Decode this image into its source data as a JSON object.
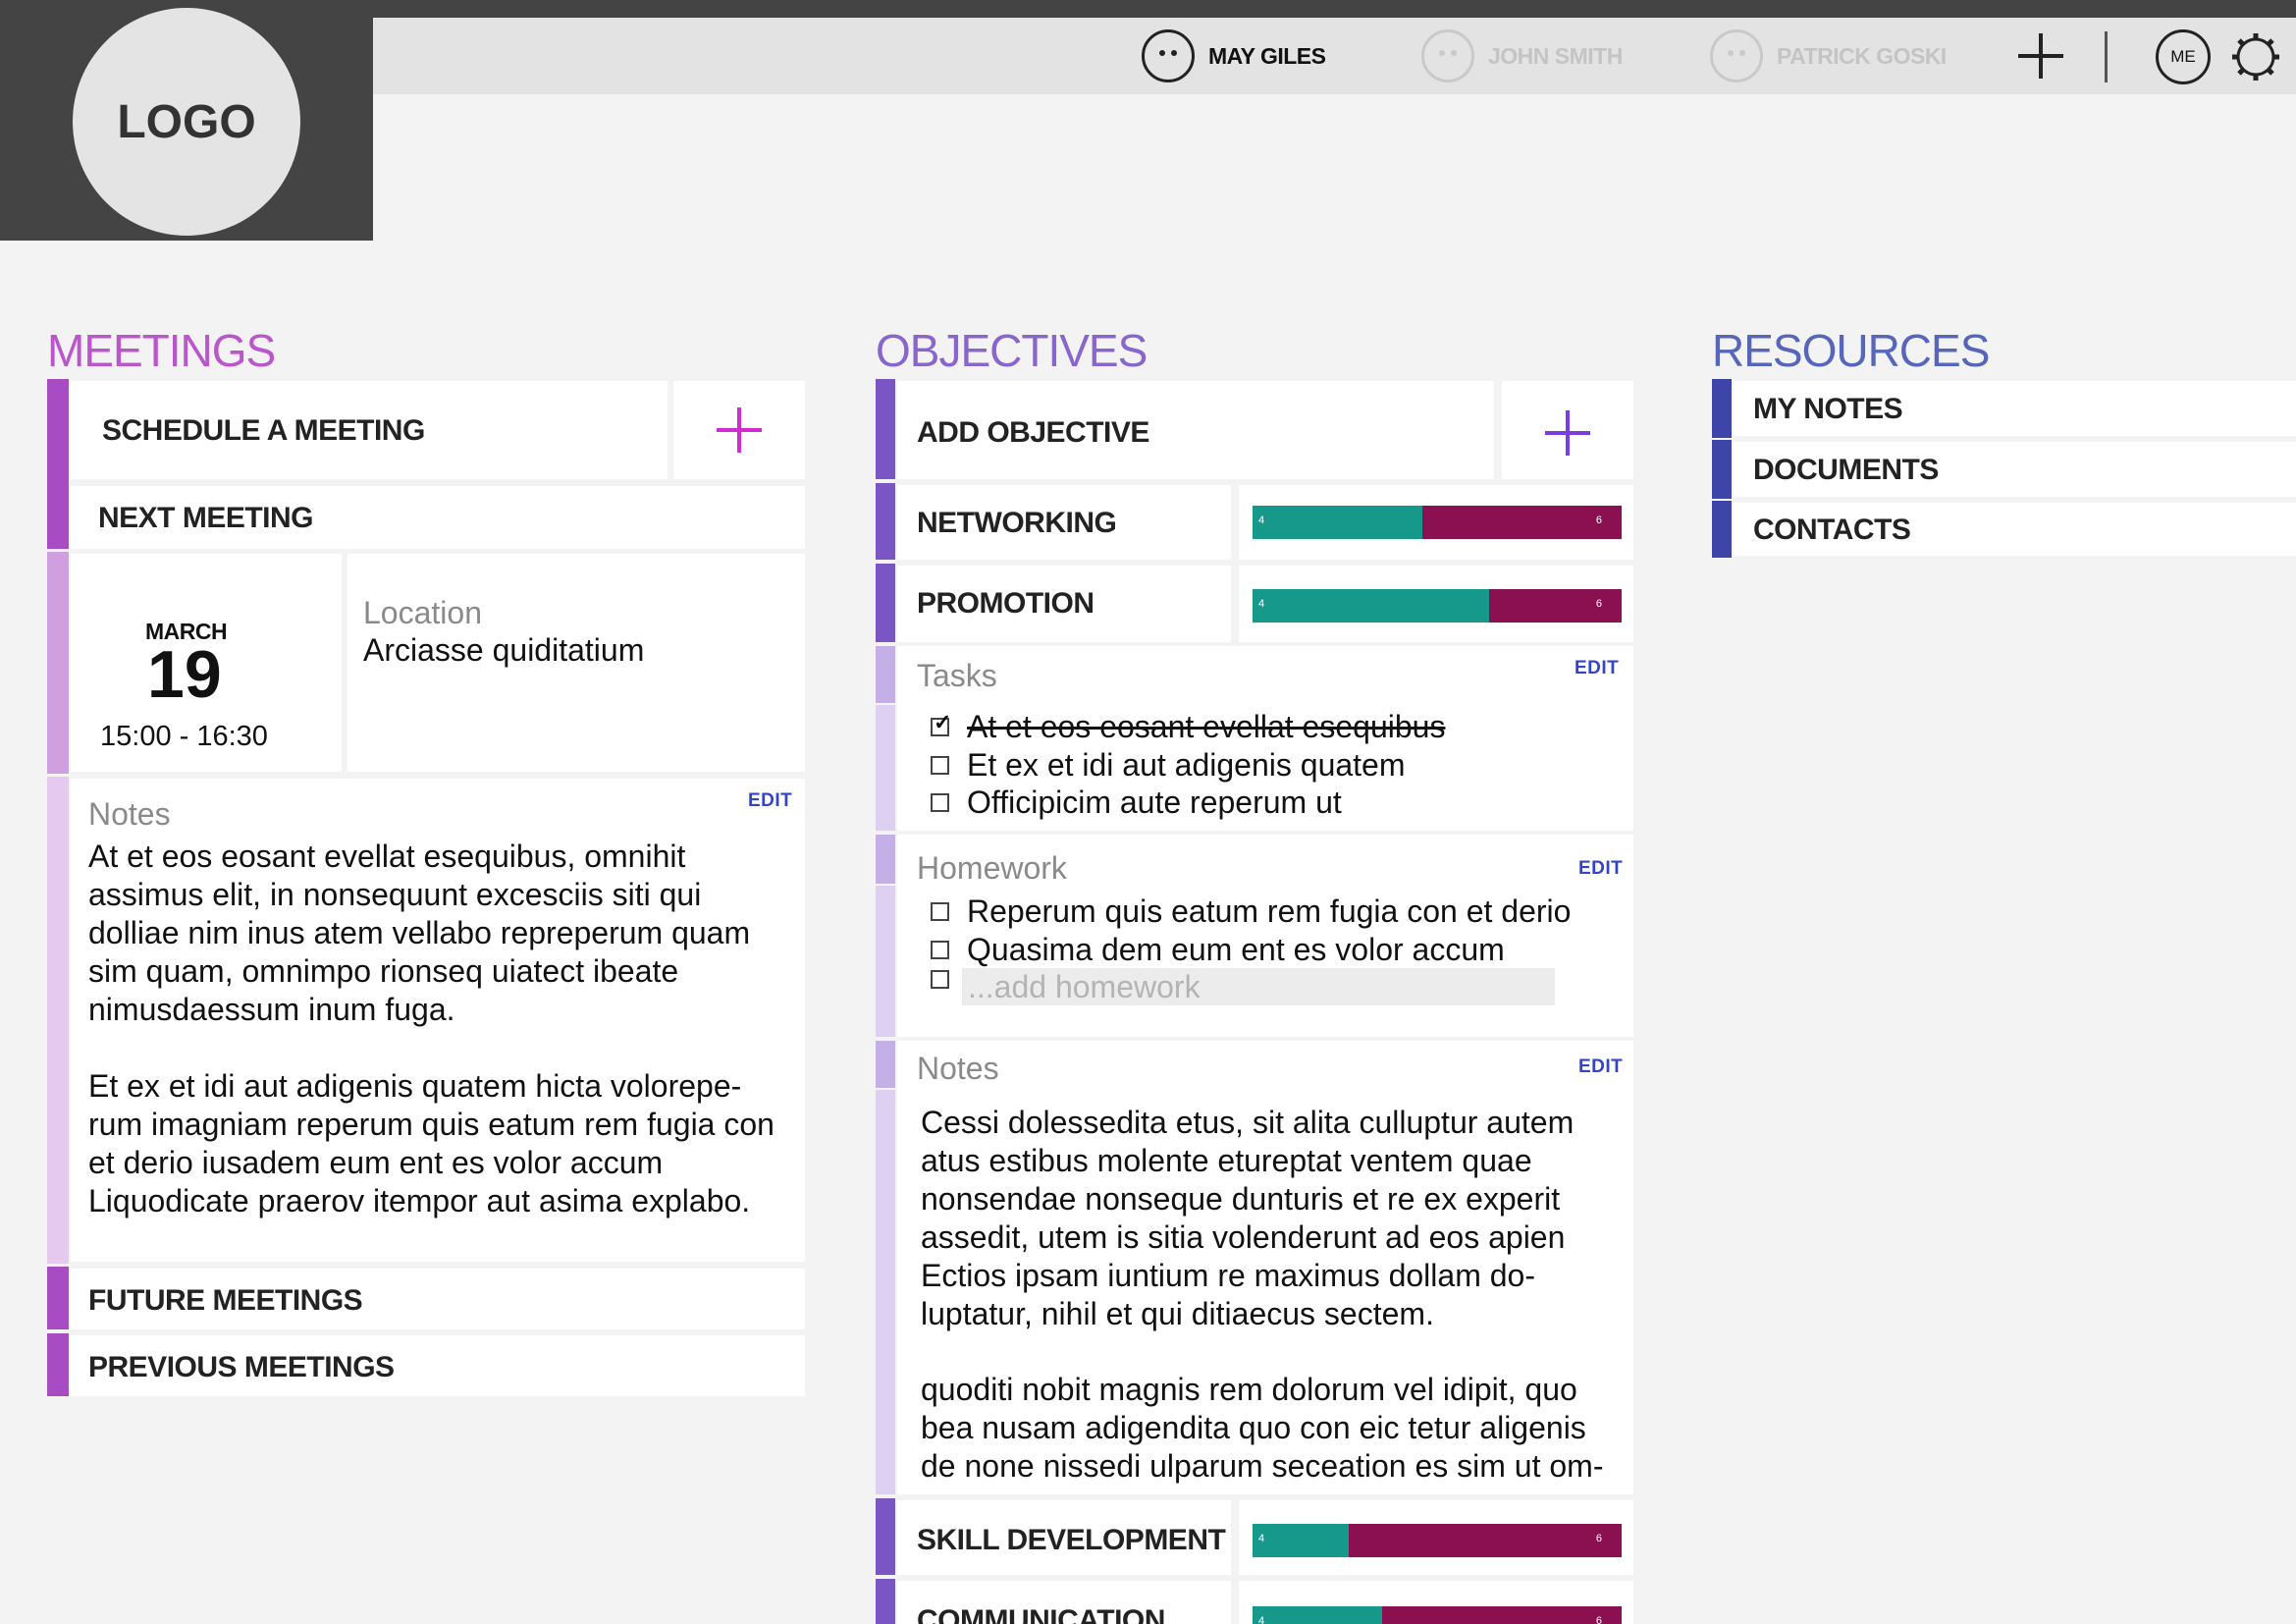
{
  "header": {
    "logo": "LOGO",
    "users": [
      {
        "name": "MAY GILES",
        "active": true
      },
      {
        "name": "JOHN SMITH",
        "active": false
      },
      {
        "name": "PATRICK GOSKI",
        "active": false
      }
    ],
    "me_label": "ME",
    "icons": [
      "face-icon",
      "plus-icon",
      "me-icon",
      "gear-icon"
    ]
  },
  "meetings": {
    "title": "MEETINGS",
    "schedule_label": "SCHEDULE A MEETING",
    "next_label": "NEXT MEETING",
    "next": {
      "month": "MARCH",
      "day": "19",
      "time": "15:00 - 16:30",
      "location_label": "Location",
      "location": "Arciasse quiditatium"
    },
    "notes_label": "Notes",
    "edit_label": "EDIT",
    "notes_p1": "At et eos eosant evellat esequibus, omnihit assimus elit, in nonsequunt excesciis siti qui dolliae nim inus atem vellabo repreperum quam sim quam, omnimpo rionseq uiatect ibeate nimusdaessum inum fuga.",
    "notes_p2": "Et ex et idi aut adigenis quatem hicta volorepe-rum imagniam reperum quis eatum rem fugia con et derio iusadem eum ent es volor accum Liquodicate praerov itempor aut asima explabo.",
    "future_label": "FUTURE MEETINGS",
    "previous_label": "PREVIOUS MEETINGS"
  },
  "objectives": {
    "title": "OBJECTIVES",
    "add_label": "ADD OBJECTIVE",
    "items": [
      {
        "label": "NETWORKING",
        "done": 4,
        "todo": 6,
        "progress": 0.46
      },
      {
        "label": "PROMOTION",
        "done": 4,
        "todo": 6,
        "progress": 0.64
      },
      {
        "label": "SKILL DEVELOPMENT",
        "done": 4,
        "todo": 6,
        "progress": 0.26
      },
      {
        "label": "COMMUNICATION",
        "done": 4,
        "todo": 6,
        "progress": 0.35
      }
    ],
    "tasks_label": "Tasks",
    "tasks": [
      {
        "text": "At et eos eosant evellat esequibus",
        "checked": true
      },
      {
        "text": "Et ex et idi aut adigenis quatem",
        "checked": false
      },
      {
        "text": "Officipicim aute reperum ut",
        "checked": false
      }
    ],
    "homework_label": "Homework",
    "homework": [
      {
        "text": "Reperum quis eatum rem fugia con et derio",
        "checked": false
      },
      {
        "text": "Quasima dem eum ent es volor accum",
        "checked": false
      }
    ],
    "add_homework_placeholder": "...add homework",
    "notes_label": "Notes",
    "edit_label": "EDIT",
    "notes_p1": "Cessi dolessedita etus, sit alita culluptur autem atus estibus molente etureptat ventem quae nonsendae nonseque dunturis et re ex experit assedit, utem is sitia volenderunt ad eos apien Ectios ipsam iuntium re maximus dollam do-luptatur, nihil et qui ditiaecus sectem.",
    "notes_p2": "quoditi nobit magnis rem dolorum vel idipit, quo bea nusam adigendita quo con eic tetur aligenis de none nissedi ulparum seceation es sim ut om-"
  },
  "resources": {
    "title": "RESOURCES",
    "items": [
      "MY NOTES",
      "DOCUMENTS",
      "CONTACTS"
    ]
  },
  "colors": {
    "meetings_bar": "#a74cc3",
    "meetings_light": "#cf9fdf",
    "meetings_lighter": "#e6c9ee",
    "objectives_bar": "#7a55c4",
    "objectives_light": "#c4b0e6",
    "objectives_lighter": "#ddd0f1",
    "resources_bar": "#3d46a8",
    "progress_done": "#16998a",
    "progress_todo": "#8b1052",
    "plus_magenta": "#d42ad4",
    "plus_violet": "#7a3ee0"
  }
}
